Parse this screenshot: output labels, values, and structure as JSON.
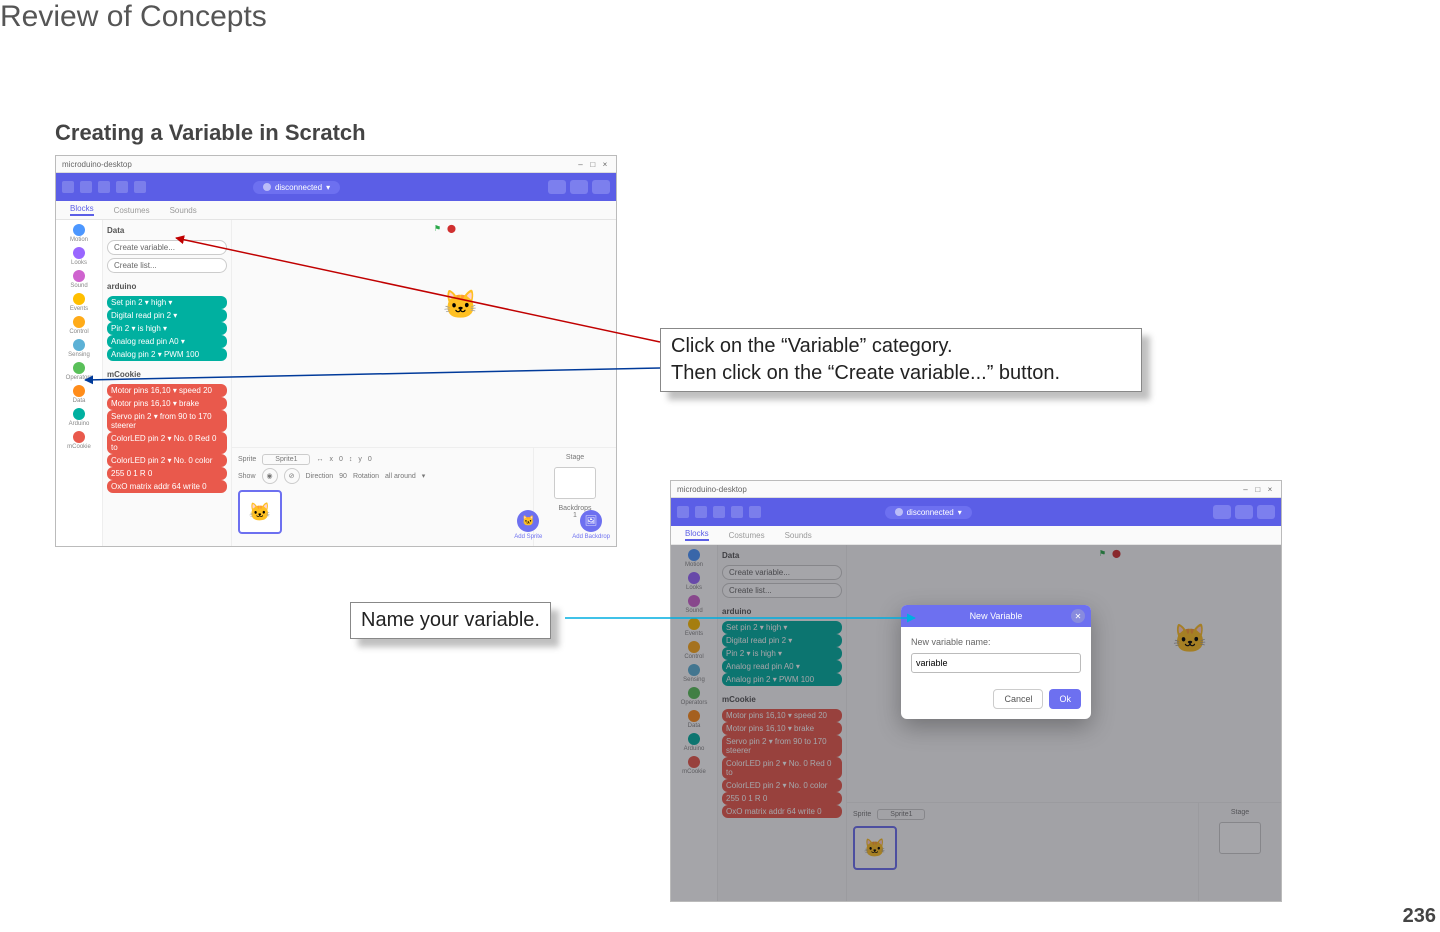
{
  "page": {
    "title": "Review of Concepts",
    "section": "Creating a Variable in Scratch",
    "number": "236"
  },
  "callouts": {
    "c1_line1": "Click on the “Variable” category.",
    "c1_line2": "Then click on the “Create variable...” button.",
    "c2": "Name your variable."
  },
  "scratch": {
    "window_title": "microduino-desktop",
    "win_min": "–",
    "win_max": "□",
    "win_close": "×",
    "connection": "disconnected",
    "chevron": "▾",
    "tabs": {
      "blocks": "Blocks",
      "costumes": "Costumes",
      "sounds": "Sounds"
    },
    "categories": [
      {
        "name": "Motion",
        "color": "#4c97ff"
      },
      {
        "name": "Looks",
        "color": "#9966ff"
      },
      {
        "name": "Sound",
        "color": "#cf63cf"
      },
      {
        "name": "Events",
        "color": "#ffbf00"
      },
      {
        "name": "Control",
        "color": "#ffab19"
      },
      {
        "name": "Sensing",
        "color": "#5cb1d6"
      },
      {
        "name": "Operators",
        "color": "#59c059"
      },
      {
        "name": "Data",
        "color": "#ff8c1a"
      },
      {
        "name": "Arduino",
        "color": "#00b0a0"
      },
      {
        "name": "mCookie",
        "color": "#e9594c"
      }
    ],
    "data_group": "Data",
    "create_variable": "Create variable...",
    "create_list": "Create list...",
    "arduino_group": "arduino",
    "arduino_blocks": [
      "Set pin 2 ▾ high ▾",
      "Digital read pin 2 ▾",
      "Pin 2 ▾ is high ▾",
      "Analog read pin A0 ▾",
      "Analog pin 2 ▾ PWM 100"
    ],
    "mcookie_group": "mCookie",
    "mcookie_blocks": [
      "Motor pins 16,10 ▾ speed 20",
      "Motor pins 16,10 ▾ brake",
      "Servo pin 2 ▾ from 90 to 170 steerer",
      "ColorLED pin 2 ▾ No. 0 Red 0 to",
      "ColorLED pin 2 ▾ No. 0 color",
      "255 0 1 R 0",
      "OxO matrix addr 64 write 0"
    ],
    "sprite_section": {
      "sprite_label": "Sprite",
      "sprite_name": "Sprite1",
      "x_label": "x",
      "x_val": "0",
      "y_label": "y",
      "y_val": "0",
      "show_label": "Show",
      "size_label": "Direction",
      "size_val": "90",
      "rotation_label": "Rotation",
      "rotation_val": "all around",
      "stage_label": "Stage",
      "backdrops_label": "Backdrops",
      "backdrops_val": "1",
      "add_sprite": "Add Sprite",
      "add_backdrop": "Add Backdrop"
    },
    "dialog": {
      "title": "New Variable",
      "prompt": "New variable name:",
      "value": "variable",
      "cancel": "Cancel",
      "ok": "Ok"
    },
    "cat_emoji": "🐱",
    "flag": "⚑",
    "stop": "⬤"
  }
}
